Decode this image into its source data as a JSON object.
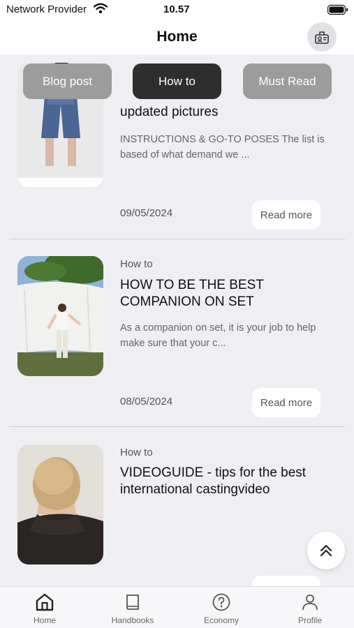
{
  "status_bar": {
    "carrier": "Network Provider",
    "time": "10.57"
  },
  "header": {
    "title": "Home",
    "action_icon": "user-card-icon"
  },
  "filters": [
    {
      "label": "Blog post",
      "selected": false
    },
    {
      "label": "How to",
      "selected": true
    },
    {
      "label": "Must Read",
      "selected": false
    }
  ],
  "posts": [
    {
      "title": "updated pictures",
      "excerpt": "INSTRUCTIONS & GO-TO POSES The list is based of what demand we ...",
      "date": "09/05/2024",
      "read_more": "Read more"
    },
    {
      "category": "How to",
      "title": "HOW TO BE THE BEST COMPANION ON SET",
      "excerpt": "As a companion on set, it is your job to help make sure that your c...",
      "date": "08/05/2024",
      "read_more": "Read more"
    },
    {
      "category": "How to",
      "title": "VIDEOGUIDE - tips for the best international castingvideo"
    }
  ],
  "tab_bar": [
    {
      "label": "Home",
      "icon": "home-icon"
    },
    {
      "label": "Handbooks",
      "icon": "book-icon"
    },
    {
      "label": "Economy",
      "icon": "question-circle-icon"
    },
    {
      "label": "Profile",
      "icon": "person-icon"
    }
  ],
  "colors": {
    "chip_active": "#2e2e2e",
    "chip_inactive": "#9c9c9c",
    "background": "#efeff3"
  }
}
